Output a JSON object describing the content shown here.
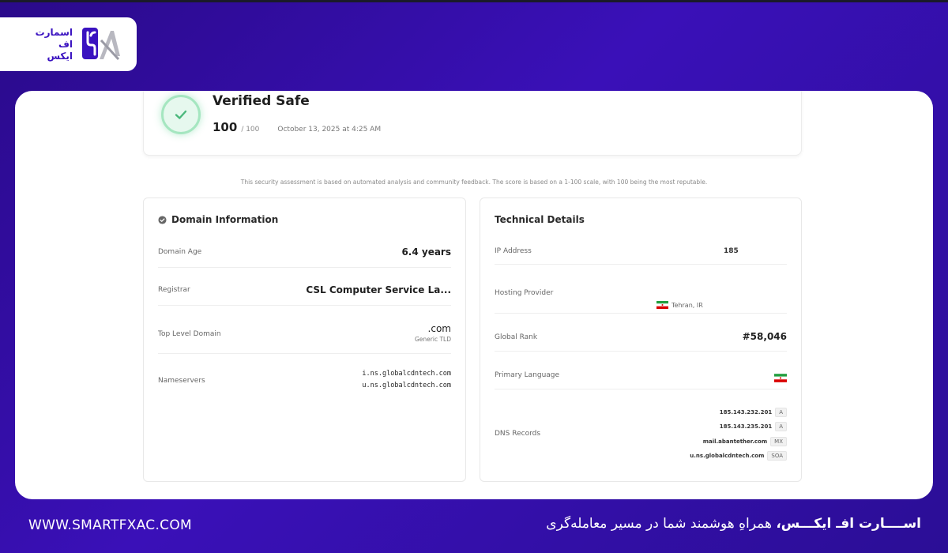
{
  "brand": {
    "logo_lines": [
      "اسمارت",
      "اف",
      "ایکس"
    ],
    "website": "WWW.SMARTFXAC.COM",
    "tagline_brand": "اســــارت افـ ایکـــس،",
    "tagline_rest": " همراهِ هوشمند شما در مسیر معامله‌گری",
    "accent_color": "#3a12c0",
    "background_color": "#2e0ea8"
  },
  "verification": {
    "icon": "check-icon",
    "title": "Verified Safe",
    "score": "100",
    "score_max": "/ 100",
    "date": "October 13, 2025 at 4:25 AM",
    "status_color": "#5cc98a"
  },
  "disclaimer": "This security assessment is based on automated analysis and community feedback. The score is based on a 1-100 scale, with 100 being the most reputable.",
  "domain_info": {
    "title": "Domain Information",
    "icon": "shield-check-icon",
    "domain_age_label": "Domain Age",
    "domain_age_value": "6.4 years",
    "registrar_label": "Registrar",
    "registrar_value": "CSL Computer Service La...",
    "tld_label": "Top Level Domain",
    "tld_value": ".com",
    "tld_sub": "Generic TLD",
    "nameservers_label": "Nameservers",
    "nameservers": [
      "i.ns.globalcdntech.com",
      "u.ns.globalcdntech.com"
    ]
  },
  "technical": {
    "title": "Technical Details",
    "ip_label": "IP Address",
    "ip_value": "185",
    "hosting_label": "Hosting Provider",
    "hosting_value": "Tehran, IR",
    "hosting_flag": "iran-flag-icon",
    "rank_label": "Global Rank",
    "rank_value": "#58,046",
    "language_label": "Primary Language",
    "language_flag": "iran-flag-icon",
    "dns_label": "DNS Records",
    "dns_records": [
      {
        "host": "185.143.232.201",
        "type": "A"
      },
      {
        "host": "185.143.235.201",
        "type": "A"
      },
      {
        "host": "mail.abantether.com",
        "type": "MX"
      },
      {
        "host": "u.ns.globalcdntech.com",
        "type": "SOA"
      }
    ]
  }
}
